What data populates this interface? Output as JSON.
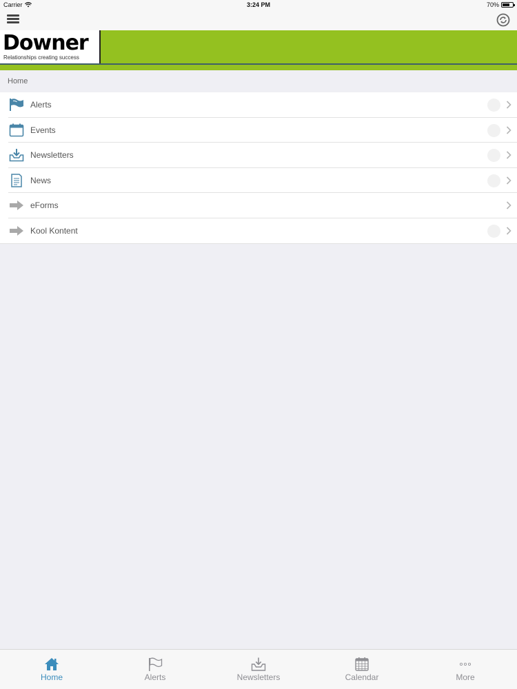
{
  "status_bar": {
    "carrier": "Carrier",
    "time": "3:24 PM",
    "battery": "70%",
    "battery_level": 0.7
  },
  "nav": {
    "menu_icon": "hamburger-icon",
    "sync_icon": "sync-icon"
  },
  "banner": {
    "logo": "Downer",
    "tagline": "Relationships creating success",
    "color": "#94c120"
  },
  "breadcrumb": "Home",
  "menu": {
    "items": [
      {
        "label": "Alerts",
        "icon": "flag-icon"
      },
      {
        "label": "Events",
        "icon": "calendar-icon"
      },
      {
        "label": "Newsletters",
        "icon": "inbox-download-icon"
      },
      {
        "label": "News",
        "icon": "document-icon"
      },
      {
        "label": "eForms",
        "icon": "arrow-right-icon"
      },
      {
        "label": "Kool Kontent",
        "icon": "arrow-right-icon"
      }
    ]
  },
  "tabs": [
    {
      "label": "Home",
      "icon": "home-icon",
      "active": true
    },
    {
      "label": "Alerts",
      "icon": "flag-icon"
    },
    {
      "label": "Newsletters",
      "icon": "inbox-download-icon"
    },
    {
      "label": "Calendar",
      "icon": "calendar-icon"
    },
    {
      "label": "More",
      "icon": "more-icon"
    }
  ],
  "colors": {
    "accent": "#3c8dbc",
    "brand_green": "#94c120",
    "icon_teal": "#4a86a8"
  }
}
